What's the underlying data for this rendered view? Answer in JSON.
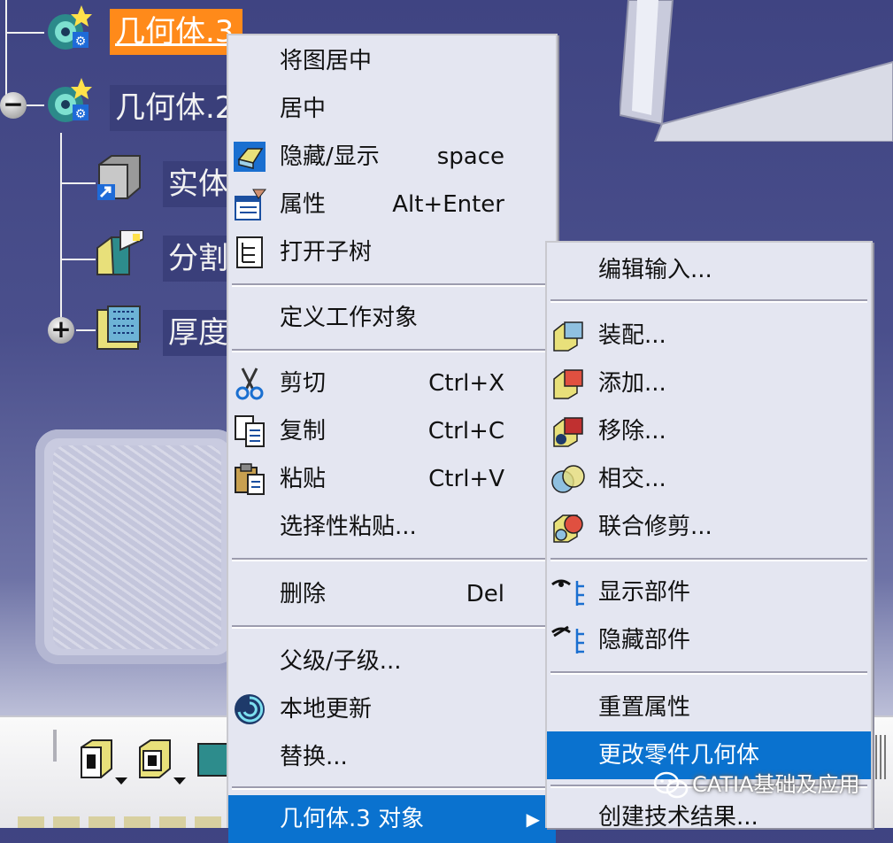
{
  "tree": {
    "nodes": [
      {
        "label": "几何体.3",
        "selected": true
      },
      {
        "label": "几何体.2",
        "selected": false
      },
      {
        "label": "实体",
        "selected": false
      },
      {
        "label": "分割",
        "selected": false
      },
      {
        "label": "厚度",
        "selected": false
      }
    ],
    "expander_minus": "−",
    "expander_plus": "+"
  },
  "context_menu": {
    "items": [
      {
        "label": "将图居中",
        "shortcut": "",
        "icon": ""
      },
      {
        "label": "居中",
        "shortcut": "",
        "icon": ""
      },
      {
        "label": "隐藏/显示",
        "shortcut": "space",
        "icon": "hide-show-icon"
      },
      {
        "label": "属性",
        "shortcut": "Alt+Enter",
        "icon": "properties-icon"
      },
      {
        "label": "打开子树",
        "shortcut": "",
        "icon": "open-subtree-icon"
      },
      {
        "label": "定义工作对象",
        "shortcut": "",
        "icon": ""
      },
      {
        "label": "剪切",
        "shortcut": "Ctrl+X",
        "icon": "scissors-icon"
      },
      {
        "label": "复制",
        "shortcut": "Ctrl+C",
        "icon": "copy-icon"
      },
      {
        "label": "粘贴",
        "shortcut": "Ctrl+V",
        "icon": "paste-icon"
      },
      {
        "label": "选择性粘贴...",
        "shortcut": "",
        "icon": ""
      },
      {
        "label": "删除",
        "shortcut": "Del",
        "icon": ""
      },
      {
        "label": "父级/子级...",
        "shortcut": "",
        "icon": ""
      },
      {
        "label": "本地更新",
        "shortcut": "",
        "icon": "local-update-icon"
      },
      {
        "label": "替换...",
        "shortcut": "",
        "icon": ""
      },
      {
        "label": "几何体.3 对象",
        "shortcut": "",
        "icon": ""
      }
    ]
  },
  "submenu": {
    "items": [
      {
        "label": "编辑输入...",
        "icon": ""
      },
      {
        "label": "装配...",
        "icon": "assemble-icon"
      },
      {
        "label": "添加...",
        "icon": "add-icon"
      },
      {
        "label": "移除...",
        "icon": "remove-icon"
      },
      {
        "label": "相交...",
        "icon": "intersect-icon"
      },
      {
        "label": "联合修剪...",
        "icon": "union-trim-icon"
      },
      {
        "label": "显示部件",
        "icon": "show-components-icon"
      },
      {
        "label": "隐藏部件",
        "icon": "hide-components-icon"
      },
      {
        "label": "重置属性",
        "icon": ""
      },
      {
        "label": "更改零件几何体",
        "icon": ""
      },
      {
        "label": "创建技术结果...",
        "icon": ""
      }
    ]
  },
  "watermark": {
    "text": "CATIA基础及应用"
  },
  "colors": {
    "highlight": "#0a72cf",
    "selected_tree": "#ff8a1a",
    "menu_bg": "#e4e6f1"
  }
}
